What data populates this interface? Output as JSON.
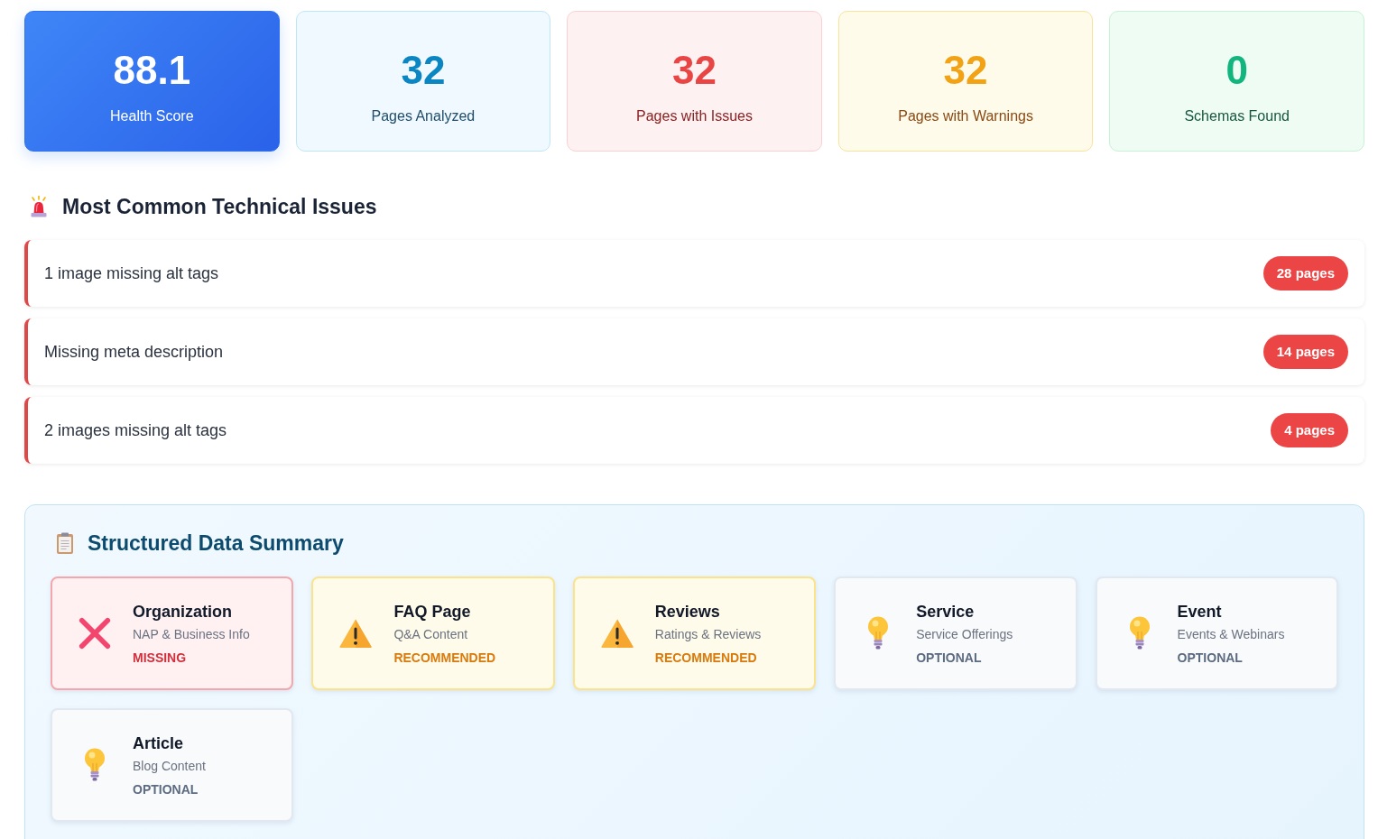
{
  "stats": [
    {
      "value": "88.1",
      "label": "Health Score",
      "kind": "score"
    },
    {
      "value": "32",
      "label": "Pages Analyzed",
      "kind": "info"
    },
    {
      "value": "32",
      "label": "Pages with Issues",
      "kind": "danger"
    },
    {
      "value": "32",
      "label": "Pages with Warnings",
      "kind": "warning"
    },
    {
      "value": "0",
      "label": "Schemas Found",
      "kind": "success"
    }
  ],
  "issues_section": {
    "title": "Most Common Technical Issues",
    "issues": [
      {
        "text": "1 image missing alt tags",
        "count": "28 pages"
      },
      {
        "text": "Missing meta description",
        "count": "14 pages"
      },
      {
        "text": "2 images missing alt tags",
        "count": "4 pages"
      }
    ]
  },
  "structured_data": {
    "title": "Structured Data Summary",
    "schemas": [
      {
        "name": "Organization",
        "description": "NAP & Business Info",
        "status": "MISSING",
        "kind": "missing"
      },
      {
        "name": "FAQ Page",
        "description": "Q&A Content",
        "status": "RECOMMENDED",
        "kind": "recommended"
      },
      {
        "name": "Reviews",
        "description": "Ratings & Reviews",
        "status": "RECOMMENDED",
        "kind": "recommended"
      },
      {
        "name": "Service",
        "description": "Service Offerings",
        "status": "OPTIONAL",
        "kind": "optional"
      },
      {
        "name": "Event",
        "description": "Events & Webinars",
        "status": "OPTIONAL",
        "kind": "optional"
      },
      {
        "name": "Article",
        "description": "Blog Content",
        "status": "OPTIONAL",
        "kind": "optional"
      }
    ]
  }
}
